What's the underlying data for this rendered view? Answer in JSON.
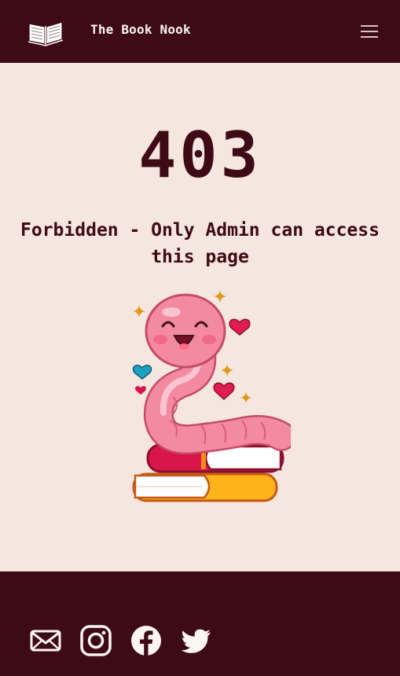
{
  "header": {
    "brand": "The Book Nook",
    "logo_icon": "open-book-icon",
    "menu_icon": "hamburger-menu-icon"
  },
  "error": {
    "code": "403",
    "message": "Forbidden - Only Admin can access this page",
    "illustration": "worm-on-books-illustration"
  },
  "footer": {
    "social": [
      {
        "name": "email",
        "icon": "envelope-icon"
      },
      {
        "name": "instagram",
        "icon": "instagram-icon"
      },
      {
        "name": "facebook",
        "icon": "facebook-icon"
      },
      {
        "name": "twitter",
        "icon": "twitter-icon"
      }
    ]
  },
  "colors": {
    "header_bg": "#3e0a16",
    "page_bg": "#f5e6df",
    "text_dark": "#3e0a16",
    "footer_bg": "#3e0a16",
    "icon_light": "#fdf6f2"
  }
}
